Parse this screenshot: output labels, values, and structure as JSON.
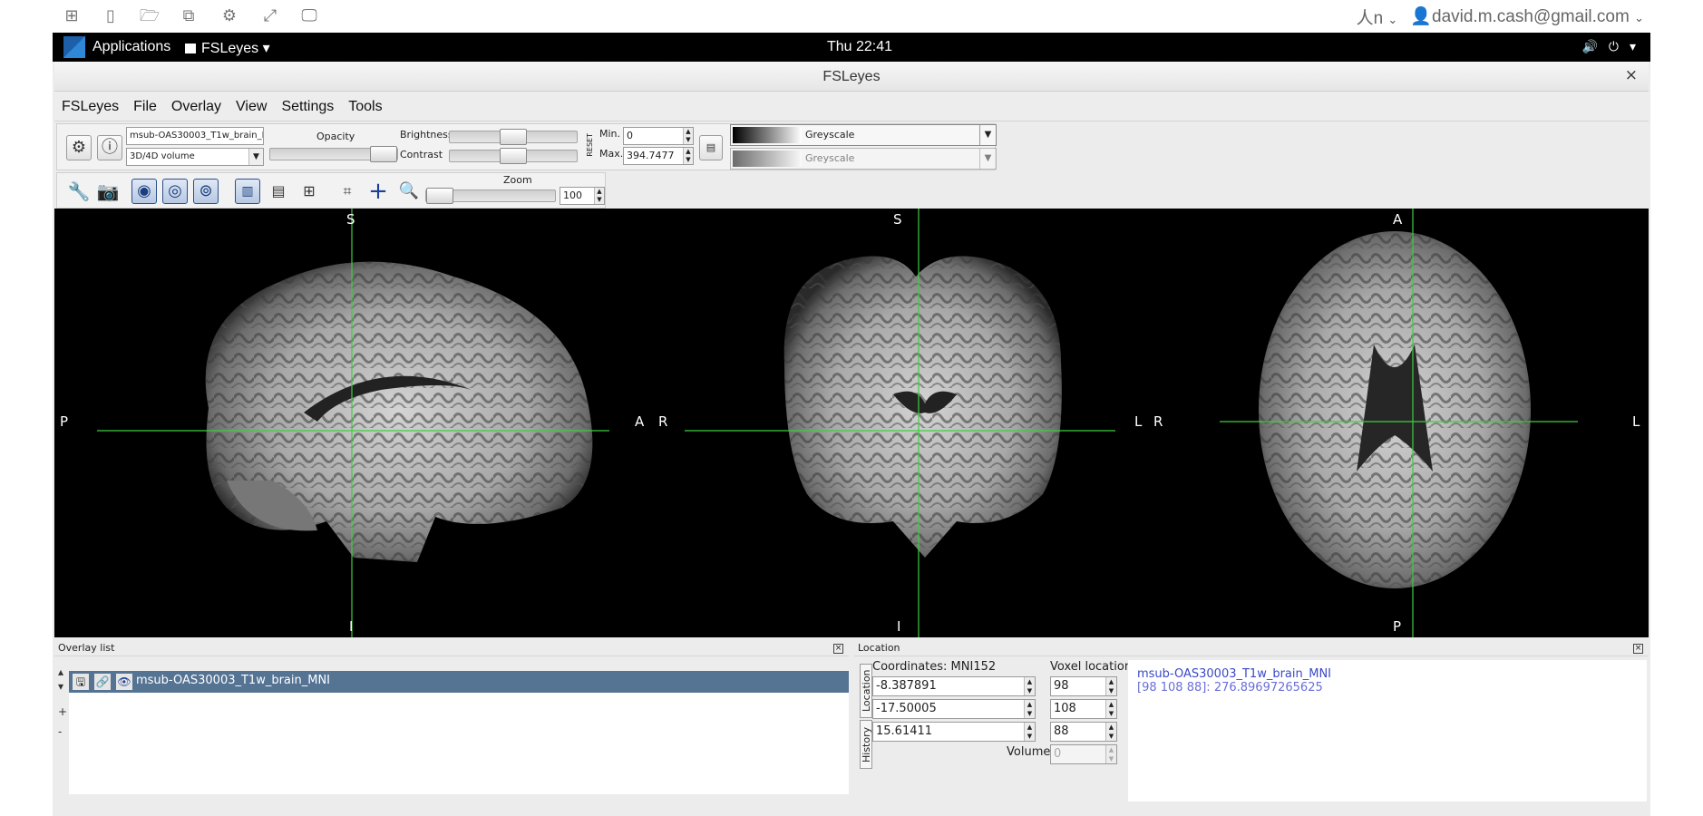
{
  "host": {
    "input_method": "⼈n",
    "account": "david.m.cash@gmail.com",
    "icons": [
      "grid-icon",
      "columns-icon",
      "folder-icon",
      "copy-icon",
      "gear-icon",
      "fullscreen-icon",
      "monitor-icon"
    ]
  },
  "gnome": {
    "applications": "Applications",
    "app_name": "FSLeyes",
    "clock": "Thu 22:41"
  },
  "window": {
    "title": "FSLeyes",
    "close": "×"
  },
  "menu": [
    "FSLeyes",
    "File",
    "Overlay",
    "View",
    "Settings",
    "Tools"
  ],
  "overlay_toolbar": {
    "overlay_name": "msub-OAS30003_T1w_brain_N",
    "overlay_type": "3D/4D volume",
    "opacity_label": "Opacity",
    "brightness_label": "Brightness",
    "contrast_label": "Contrast",
    "reset_label": "RESET",
    "min_label": "Min.",
    "max_label": "Max.",
    "min_value": "0",
    "max_value": "394.7477",
    "cmap_primary": "Greyscale",
    "cmap_secondary": "Greyscale",
    "opacity_level": 1.0,
    "brightness_level": 0.5,
    "contrast_level": 0.5
  },
  "ortho_toolbar": {
    "zoom_label": "Zoom",
    "zoom_value": "100",
    "zoom_level": 0
  },
  "views": {
    "sagittal": {
      "top": "S",
      "bottom": "I",
      "left": "P",
      "right": "A"
    },
    "coronal": {
      "top": "S",
      "bottom": "I",
      "left": "R",
      "right": "L"
    },
    "axial": {
      "top": "A",
      "bottom": "P",
      "left": "R",
      "right": "L"
    }
  },
  "overlay_panel": {
    "title": "Overlay list",
    "close": "×",
    "row_name": "msub-OAS30003_T1w_brain_MNI",
    "add": "+",
    "remove": "-",
    "up": "▴",
    "down": "▾"
  },
  "location_panel": {
    "title": "Location",
    "close": "×",
    "coords_label": "Coordinates: MNI152",
    "voxel_label": "Voxel location",
    "tab_location": "Location",
    "tab_history": "History",
    "x": "-8.387891",
    "y": "-17.50005",
    "z": "15.61411",
    "vx": "98",
    "vy": "108",
    "vz": "88",
    "volume_label": "Volume",
    "volume_value": "0",
    "info_name": "msub-OAS30003_T1w_brain_MNI",
    "info_value": "[98 108 88]: 276.89697265625"
  },
  "colors": {
    "crosshair": "#3ccf3c",
    "selection": "#557393",
    "info_text": "#3a49c8"
  }
}
